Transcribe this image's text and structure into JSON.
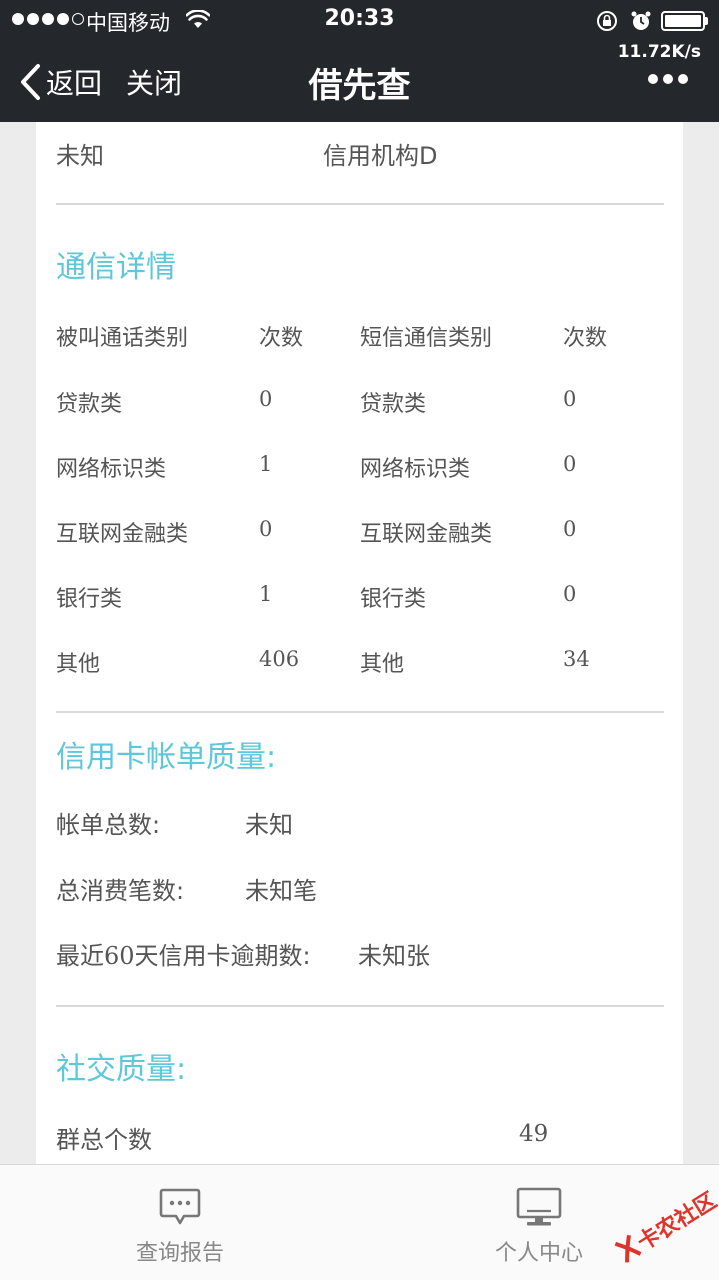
{
  "status_bar": {
    "carrier": "中国移动",
    "time": "20:33",
    "net_speed": "11.72K/s"
  },
  "nav": {
    "back_label": "返回",
    "close_label": "关闭",
    "title": "借先查"
  },
  "top_row": {
    "left": "未知",
    "right": "信用机构D"
  },
  "comm": {
    "title": "通信详情",
    "headers": [
      "被叫通话类别",
      "次数",
      "短信通信类别",
      "次数"
    ],
    "rows": [
      [
        "贷款类",
        "0",
        "贷款类",
        "0"
      ],
      [
        "网络标识类",
        "1",
        "网络标识类",
        "0"
      ],
      [
        "互联网金融类",
        "0",
        "互联网金融类",
        "0"
      ],
      [
        "银行类",
        "1",
        "银行类",
        "0"
      ],
      [
        "其他",
        "406",
        "其他",
        "34"
      ]
    ]
  },
  "credit": {
    "title": "信用卡帐单质量:",
    "rows": [
      {
        "label": "帐单总数:",
        "value": "未知"
      },
      {
        "label": "总消费笔数:",
        "value": "未知笔"
      },
      {
        "label_prefix": "最近",
        "label_num": "60",
        "label_suffix": "天信用卡逾期数:",
        "value": "未知张"
      }
    ]
  },
  "social": {
    "title": "社交质量:",
    "rows": [
      {
        "label": "群总个数",
        "value": "49"
      }
    ]
  },
  "tabbar": {
    "tabs": [
      {
        "label": "查询报告",
        "icon": "chat-bubble-icon"
      },
      {
        "label": "个人中心",
        "icon": "monitor-icon"
      }
    ]
  },
  "watermark": {
    "text": "卡农社区"
  }
}
